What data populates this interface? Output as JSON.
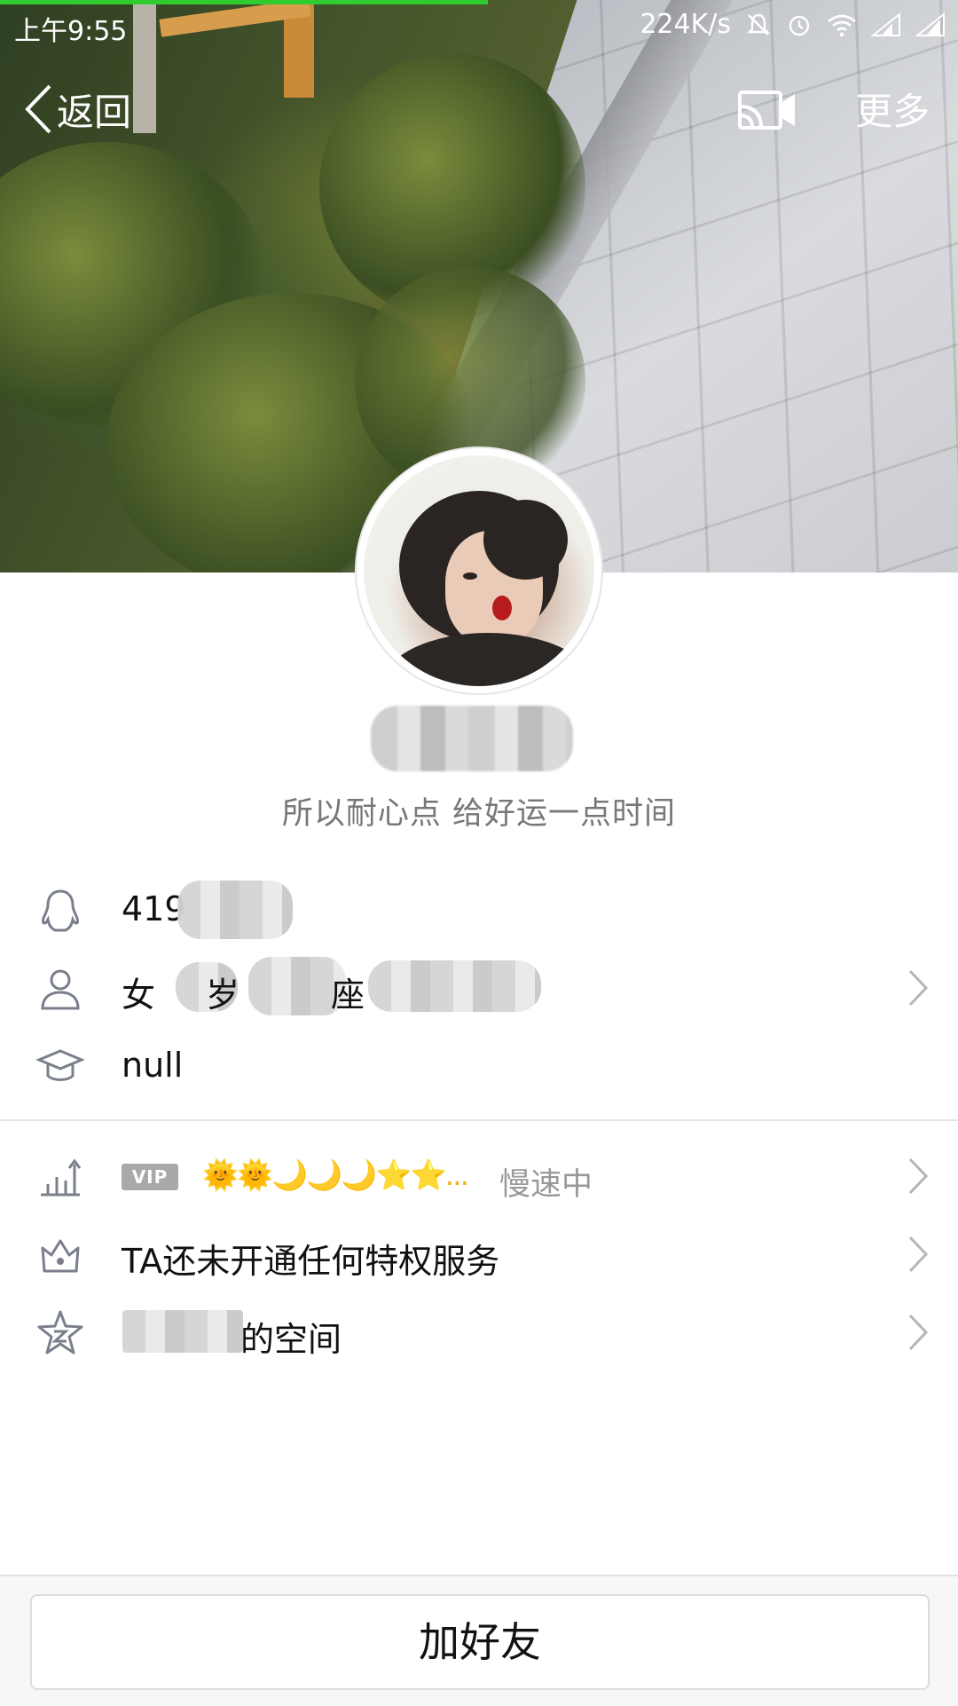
{
  "status_bar": {
    "time": "上午9:55",
    "network_speed": "224K/s"
  },
  "nav": {
    "back_label": "返回",
    "more_label": "更多"
  },
  "profile": {
    "signature": "所以耐心点  给好运一点时间"
  },
  "info": {
    "qq_number": "419",
    "gender": "女",
    "age_suffix": "岁",
    "zodiac_suffix": "座",
    "school": "null"
  },
  "services": {
    "vip_badge": "VIP",
    "level_icons": "🌞🌞🌙🌙🌙⭐⭐...",
    "level_status": "慢速中",
    "privilege_text": "TA还未开通任何特权服务",
    "space_suffix": "的空间"
  },
  "actions": {
    "add_friend_label": "加好友"
  },
  "colors": {
    "status_progress": "#2ecc2e",
    "icon_gray": "#7a7f8c",
    "level_gold": "#f2b21f"
  }
}
